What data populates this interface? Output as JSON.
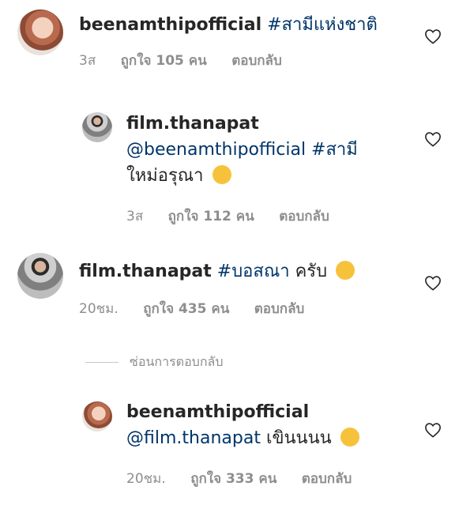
{
  "comments": [
    {
      "user": "beenamthipofficial",
      "segments": [
        {
          "text": "#สามีแห่งชาติ",
          "tag": true
        }
      ],
      "time": "3ส",
      "likes": "ถูกใจ 105 คน",
      "reply": "ตอบกลับ"
    },
    {
      "user": "film.thanapat",
      "segments": [
        {
          "text": "@beenamthipofficial #สามี",
          "tag": true
        },
        {
          "text": "ใหม่อรุณา",
          "tag": false
        }
      ],
      "emoji": "😜",
      "time": "3ส",
      "likes": "ถูกใจ 112 คน",
      "reply": "ตอบกลับ"
    },
    {
      "user": "film.thanapat",
      "segments": [
        {
          "text": "#บอสณา",
          "tag": true
        },
        {
          "text": "ครับ",
          "tag": false
        }
      ],
      "emoji": "😉",
      "time": "20ชม.",
      "likes": "ถูกใจ 435 คน",
      "reply": "ตอบกลับ"
    },
    {
      "user": "beenamthipofficial",
      "segments": [
        {
          "text": "@film.thanapat",
          "tag": true
        },
        {
          "text": "เขินนนน",
          "tag": false
        }
      ],
      "emoji": "☺️",
      "time": "20ชม.",
      "likes": "ถูกใจ 333 คน",
      "reply": "ตอบกลับ"
    }
  ],
  "hide_replies": "ซ่อนการตอบกลับ",
  "colors": {
    "tag": "#003569",
    "meta": "#8e8e8e",
    "text": "#262626"
  }
}
